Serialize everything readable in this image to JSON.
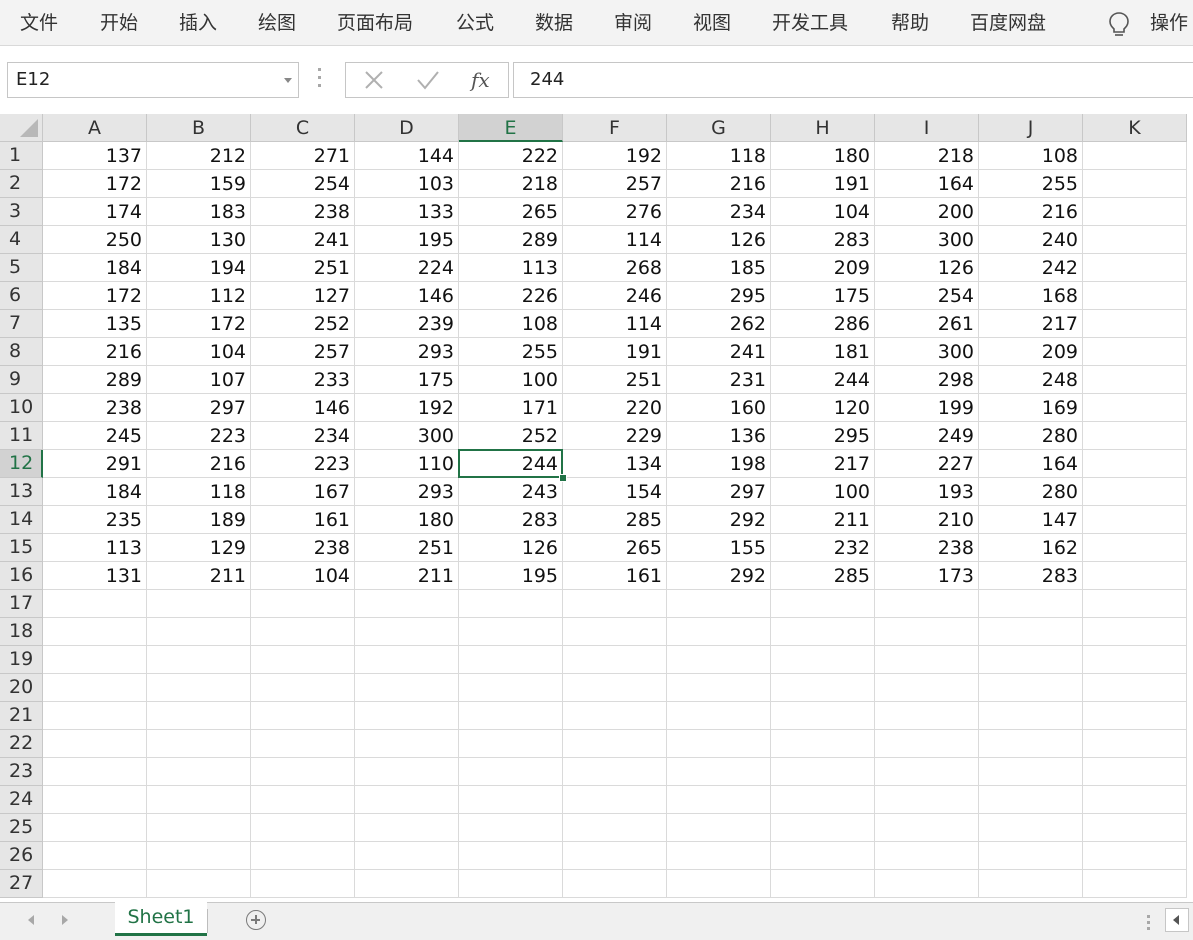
{
  "ribbon": {
    "tabs": [
      "文件",
      "开始",
      "插入",
      "绘图",
      "页面布局",
      "公式",
      "数据",
      "审阅",
      "视图",
      "开发工具",
      "帮助",
      "百度网盘"
    ],
    "tell_me": "操作"
  },
  "formula_bar": {
    "name_box": "E12",
    "fx_label": "fx",
    "value": "244"
  },
  "sheet": {
    "columns": [
      "A",
      "B",
      "C",
      "D",
      "E",
      "F",
      "G",
      "H",
      "I",
      "J",
      "K"
    ],
    "row_count": 27,
    "selected_column": "E",
    "selected_row": 12,
    "rows": [
      [
        137,
        212,
        271,
        144,
        222,
        192,
        118,
        180,
        218,
        108
      ],
      [
        172,
        159,
        254,
        103,
        218,
        257,
        216,
        191,
        164,
        255
      ],
      [
        174,
        183,
        238,
        133,
        265,
        276,
        234,
        104,
        200,
        216
      ],
      [
        250,
        130,
        241,
        195,
        289,
        114,
        126,
        283,
        300,
        240
      ],
      [
        184,
        194,
        251,
        224,
        113,
        268,
        185,
        209,
        126,
        242
      ],
      [
        172,
        112,
        127,
        146,
        226,
        246,
        295,
        175,
        254,
        168
      ],
      [
        135,
        172,
        252,
        239,
        108,
        114,
        262,
        286,
        261,
        217
      ],
      [
        216,
        104,
        257,
        293,
        255,
        191,
        241,
        181,
        300,
        209
      ],
      [
        289,
        107,
        233,
        175,
        100,
        251,
        231,
        244,
        298,
        248
      ],
      [
        238,
        297,
        146,
        192,
        171,
        220,
        160,
        120,
        199,
        169
      ],
      [
        245,
        223,
        234,
        300,
        252,
        229,
        136,
        295,
        249,
        280
      ],
      [
        291,
        216,
        223,
        110,
        244,
        134,
        198,
        217,
        227,
        164
      ],
      [
        184,
        118,
        167,
        293,
        243,
        154,
        297,
        100,
        193,
        280
      ],
      [
        235,
        189,
        161,
        180,
        283,
        285,
        292,
        211,
        210,
        147
      ],
      [
        113,
        129,
        238,
        251,
        126,
        265,
        155,
        232,
        238,
        162
      ],
      [
        131,
        211,
        104,
        211,
        195,
        161,
        292,
        285,
        173,
        283
      ]
    ]
  },
  "sheet_tabs": [
    "Sheet1"
  ],
  "colors": {
    "accent": "#217346",
    "header_bg": "#e6e6e6",
    "gridline": "#dadada"
  },
  "icons": [
    "lightbulb-icon",
    "cancel-x-icon",
    "enter-check-icon",
    "add-sheet-icon",
    "scroll-left-icon",
    "scroll-right-icon"
  ]
}
